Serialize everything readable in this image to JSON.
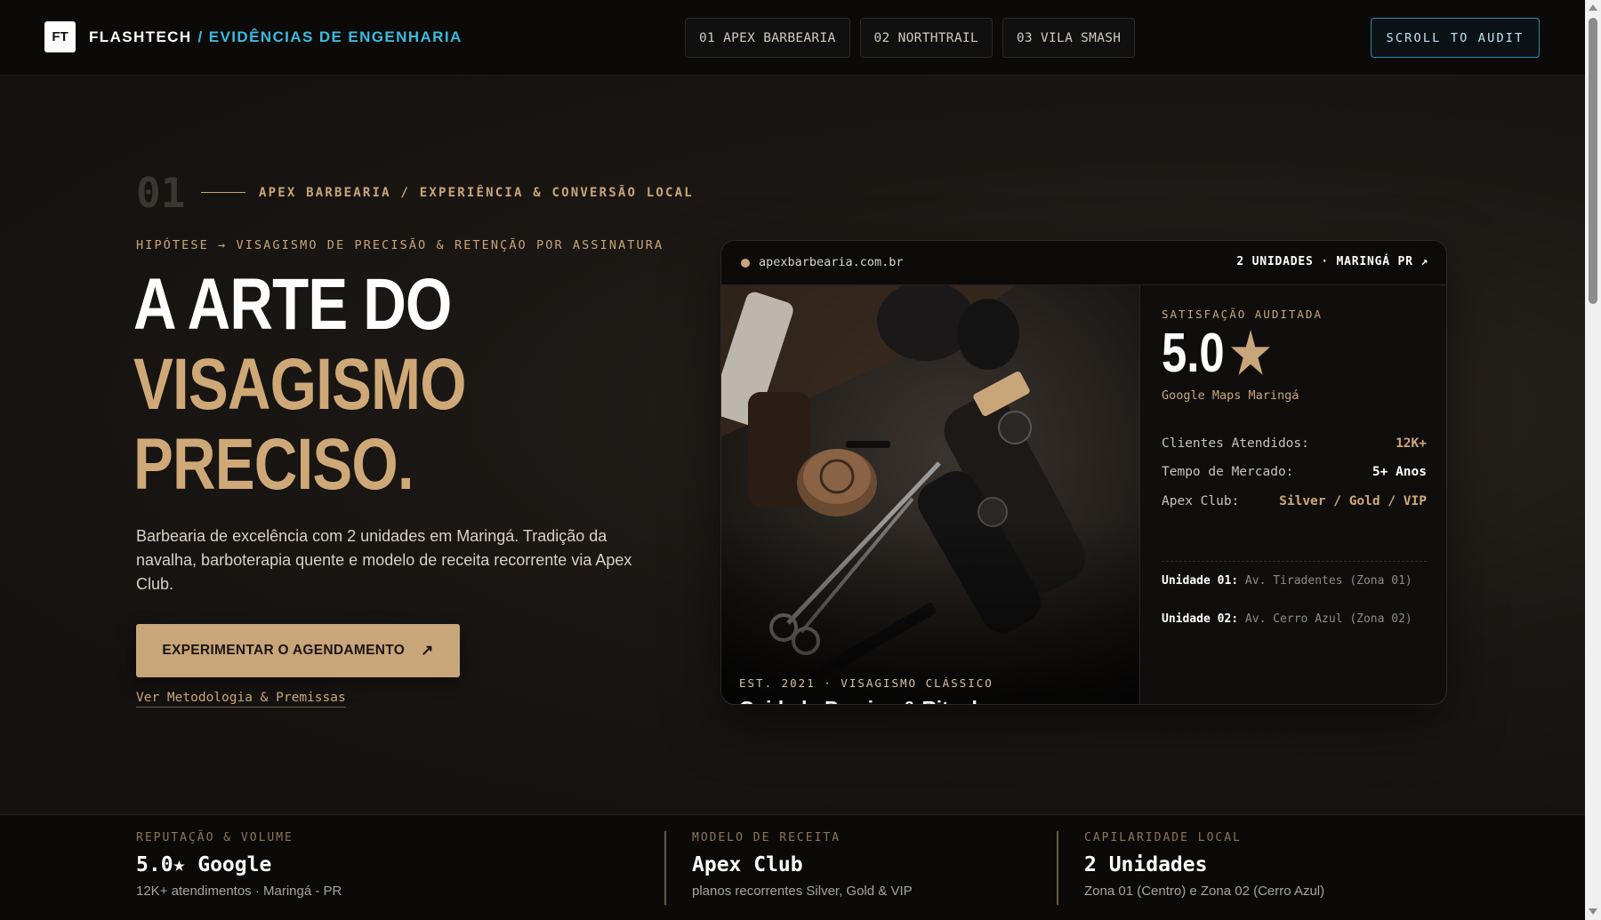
{
  "nav": {
    "brand_logo": "FT",
    "brand_name": "FLASHTECH",
    "brand_sub": "/ EVIDÊNCIAS DE ENGENHARIA",
    "tabs": [
      {
        "label": "01 APEX BARBEARIA"
      },
      {
        "label": "02 NORTHTRAIL"
      },
      {
        "label": "03 VILA SMASH"
      }
    ],
    "scroll_label": "SCROLL TO AUDIT"
  },
  "hero": {
    "section_number": "01",
    "section_label": "APEX BARBEARIA / EXPERIÊNCIA & CONVERSÃO LOCAL",
    "hypothesis": "HIPÓTESE → VISAGISMO DE PRECISÃO & RETENÇÃO POR ASSINATURA",
    "headline_line1": "A ARTE DO",
    "headline_line2": "VISAGISMO",
    "headline_line3": "PRECISO.",
    "lead": "Barbearia de excelência com 2 unidades em Maringá. Tradição da navalha, barboterapia quente e modelo de receita recorrente via Apex Club.",
    "cta_label": "EXPERIMENTAR O AGENDAMENTO",
    "cta_icon": "↗",
    "method_link": "Ver Metodologia & Premissas"
  },
  "card": {
    "domain": "apexbarbearia.com.br",
    "units_badge": "2 UNIDADES · MARINGÁ PR ↗",
    "photo_est": "EST. 2021 · VISAGISMO CLÁSSICO",
    "photo_title": "Cuidado Preciso & Ritual",
    "satisfaction_label": "SATISFAÇÃO AUDITADA",
    "rating": "5.0",
    "rating_star": "★",
    "rating_source": "Google Maps Maringá",
    "metrics": [
      {
        "key": "Clientes Atendidos:",
        "value": "12K+"
      },
      {
        "key": "Tempo de Mercado:",
        "value": "5+ Anos"
      },
      {
        "key": "Apex Club:",
        "value": "Silver / Gold / VIP"
      }
    ],
    "units": [
      {
        "label": "Unidade 01:",
        "address": "Av. Tiradentes (Zona 01)"
      },
      {
        "label": "Unidade 02:",
        "address": "Av. Cerro Azul (Zona 02)"
      }
    ]
  },
  "strip": [
    {
      "label": "REPUTAÇÃO & VOLUME",
      "value": "5.0★ Google",
      "sub": "12K+ atendimentos · Maringá - PR"
    },
    {
      "label": "MODELO DE RECEITA",
      "value": "Apex Club",
      "sub": "planos recorrentes Silver, Gold & VIP"
    },
    {
      "label": "CAPILARIDADE LOCAL",
      "value": "2 Unidades",
      "sub": "Zona 01 (Centro) e Zona 02 (Cerro Azul)"
    }
  ],
  "colors": {
    "accent_gold": "#c9a57a",
    "accent_cyan": "#3bbbe0",
    "background": "#141210"
  }
}
